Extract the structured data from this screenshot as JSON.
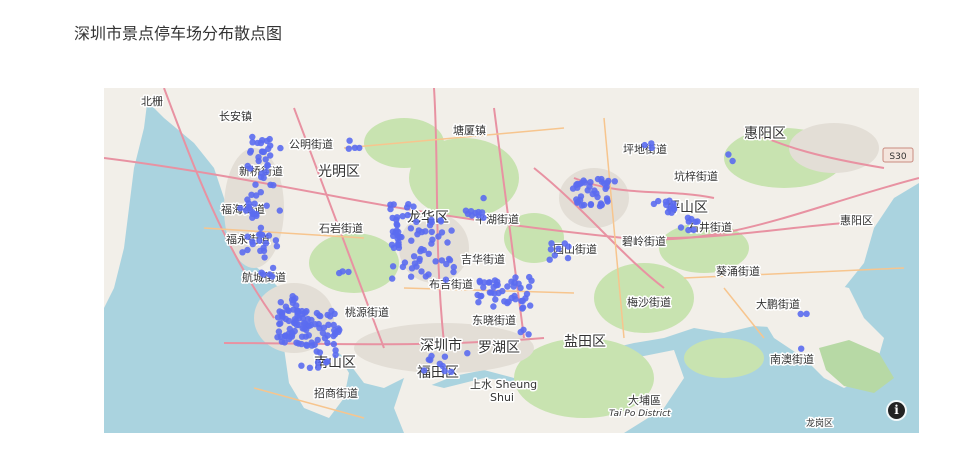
{
  "title": "深圳市景点停车场分布散点图",
  "point_color": "#5b6cf0",
  "map_labels": {
    "beizha": "北栅",
    "changan": "长安镇",
    "gongming": "公明街道",
    "guangming": "光明区",
    "tangxia": "塘厦镇",
    "huizhou": "惠阳区",
    "s30": "S30",
    "pingdi": "坪地街道",
    "kengzi": "坑梓街道",
    "pingshan": "坪山区",
    "shijing": "石井街道",
    "huiyang2": "惠阳区",
    "xinqiao": "新桥街道",
    "fuhai": "福海街道",
    "fuyong": "福永街道",
    "hangcheng": "航城街道",
    "shiyan": "石岩街道",
    "longhua": "龙华区",
    "pinghu": "平湖街道",
    "jihua": "吉华街道",
    "buji": "布吉街道",
    "yuanshan": "园山街道",
    "biling": "碧岭街道",
    "kuiyong": "葵涌街道",
    "taoyuan": "桃源街道",
    "dongxiao": "东晓街道",
    "meisha": "梅沙街道",
    "dapeng": "大鹏街道",
    "shenzhen": "深圳市",
    "luohu": "罗湖区",
    "yantian": "盐田区",
    "nanshan": "南山区",
    "futian": "福田区",
    "nanao": "南澳街道",
    "zhaoshang": "招商街道",
    "shangshui": "上水 Sheung",
    "shui": "Shui",
    "dapu": "大埔區",
    "taipo": "Tai Po District",
    "longgang2": "龙岗区"
  },
  "info_icon": "info-icon"
}
